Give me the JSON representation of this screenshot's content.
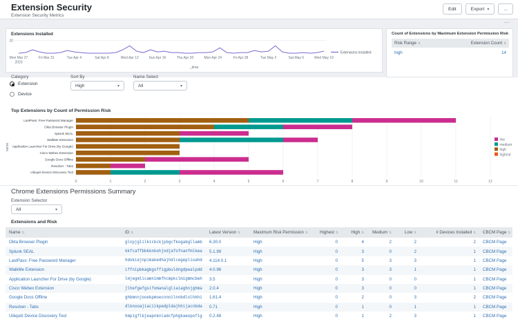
{
  "header": {
    "title": "Extension Security",
    "subtitle": "Extension Security Metrics",
    "buttons": {
      "edit": "Edit",
      "export": "Export",
      "more": "..."
    }
  },
  "line_panel": {
    "title": "Extensions Installed"
  },
  "risk_panel": {
    "title": "Count of Extensions by Maximum Extension Permission Risk",
    "columns": [
      "Risk Range",
      "Extension Count"
    ],
    "rows": [
      [
        "high",
        "14"
      ]
    ]
  },
  "filters": {
    "category_label": "Category",
    "category_options": [
      {
        "label": "Extension",
        "selected": true
      },
      {
        "label": "Device",
        "selected": false
      }
    ],
    "sort_by_label": "Sort By",
    "sort_by_value": "High",
    "name_select_label": "Name Select",
    "name_select_value": "All"
  },
  "bar_panel": {
    "title": "Top Extensions by Count of Permission Risk"
  },
  "summary": {
    "title": "Chrome Extensions Permissions Summary",
    "selector_label": "Extension Selector",
    "selector_value": "All"
  },
  "extensions_table": {
    "title": "Extensions and Risk",
    "columns": [
      "Name",
      "ID",
      "Latest Version",
      "Maximum Risk Permission",
      "Highest",
      "High",
      "Medium",
      "Low",
      "# Devices Installed",
      "CBCM Page"
    ],
    "rows": [
      [
        "Okta Browser Plugin",
        "glnpjglilkicbckjpbgcfkogabgllamb",
        "6.30.0",
        "High",
        "0",
        "4",
        "2",
        "2",
        "2",
        "CBCM Page"
      ],
      [
        "Splunk SEAL",
        "kkfcaffbbkknkohjodjafofnanfmlkea",
        "5.1.99",
        "High",
        "0",
        "3",
        "0",
        "2",
        "1",
        "CBCM Page"
      ],
      [
        "LastPass: Free Password Manager",
        "hdokiejnpimakedhajhdlcegeplioahd",
        "4.114.0.1",
        "High",
        "0",
        "5",
        "3",
        "3",
        "1",
        "CBCM Page"
      ],
      [
        "WalkMe Extension",
        "iffnipbkagbgsffigpbuldngdpealpdd",
        "4.0.96",
        "High",
        "0",
        "3",
        "3",
        "1",
        "1",
        "CBCM Page"
      ],
      [
        "Application Launcher For Drive (by Google)",
        "lmjegmlicamnimmfhcmpkclmigmmcbeh",
        "3.5",
        "High",
        "0",
        "3",
        "0",
        "0",
        "1",
        "CBCM Page"
      ],
      [
        "Cisco Webex Extension",
        "jlhefgefgsifomanalgliaiaghnjghma",
        "2.0.4",
        "High",
        "0",
        "3",
        "0",
        "0",
        "1",
        "CBCM Page"
      ],
      [
        "Google Docs Offline",
        "ghbmnnjooekpmoecnnnilnnbdlolhkhi",
        "1.61.4",
        "High",
        "0",
        "2",
        "0",
        "3",
        "2",
        "CBCM Page"
      ],
      [
        "Resolver - Tabs",
        "dlknooajiaciikpedpldajhhijacnbda",
        "0.71",
        "High",
        "0",
        "1",
        "0",
        "1",
        "1",
        "CBCM Page"
      ],
      [
        "Ubiquiti Device Discovery Tool",
        "hmpigflbjeapnknladcfphgkaeopofig",
        "0.2.48",
        "High",
        "0",
        "1",
        "2",
        "3",
        "1",
        "CBCM Page"
      ]
    ]
  },
  "chart_data": [
    {
      "type": "line",
      "title": "Extensions Installed",
      "xlabel": "_time",
      "ylabel": "",
      "ylim": [
        0,
        20
      ],
      "y_tick_labels": [
        "20"
      ],
      "series_label": "Extensions Installed",
      "line_color": "#7b6ad0",
      "x_tick_every": 4,
      "x_tick_labels": [
        "Mon Mar 27|2023",
        "Fri Mar 31",
        "Tue Apr 4",
        "Sat Apr 8",
        "Wed Apr 12",
        "Sun Apr 16",
        "Thu Apr 20",
        "Mon Apr 24",
        "Fri Apr 28",
        "Tue May 2",
        "Sat May 6",
        "Wed May 10"
      ],
      "values": [
        1,
        2,
        6,
        3,
        1,
        1,
        2,
        5,
        3,
        2,
        1,
        1,
        1,
        1,
        2,
        6,
        12,
        4,
        2,
        6,
        3,
        4,
        2,
        2,
        1,
        1,
        2,
        2,
        3,
        9,
        2,
        1,
        2,
        2,
        5,
        3,
        4,
        12,
        3,
        1,
        1,
        2,
        1,
        2,
        4
      ]
    },
    {
      "type": "bar",
      "orientation": "horizontal",
      "stacked": true,
      "title": "Top Extensions by Count of Permission Risk",
      "ylabel": "name",
      "xlim": [
        0,
        12
      ],
      "x_ticks": [
        0,
        1,
        2,
        3,
        4,
        5,
        6,
        7,
        8,
        9,
        10,
        11,
        12
      ],
      "categories": [
        "LastPass: Free Password Manager",
        "Okta Browser Plugin",
        "Splunk SEAL",
        "WalkMe Extension",
        "Application Launcher For Drive (by Google)",
        "Cisco Webex Extension",
        "Google Docs Offline",
        "Resolver - Tabs",
        "Ubiquiti Device Discovery Tool"
      ],
      "series": [
        {
          "name": "high",
          "color": "#a15f11",
          "values": [
            5,
            4,
            3,
            3,
            3,
            3,
            2,
            1,
            1
          ]
        },
        {
          "name": "medium",
          "color": "#00998f",
          "values": [
            3,
            2,
            0,
            3,
            0,
            0,
            0,
            0,
            2
          ]
        },
        {
          "name": "low",
          "color": "#cb2d8f",
          "values": [
            3,
            2,
            2,
            1,
            0,
            0,
            3,
            1,
            3
          ]
        }
      ],
      "legend": [
        {
          "name": "low",
          "color": "#cb2d8f"
        },
        {
          "name": "medium",
          "color": "#00998f"
        },
        {
          "name": "high",
          "color": "#a15f11"
        },
        {
          "name": "highest",
          "color": "#f0541e"
        }
      ]
    }
  ],
  "colors": {
    "link": "#2f70b5",
    "line": "#7b6ad0"
  }
}
